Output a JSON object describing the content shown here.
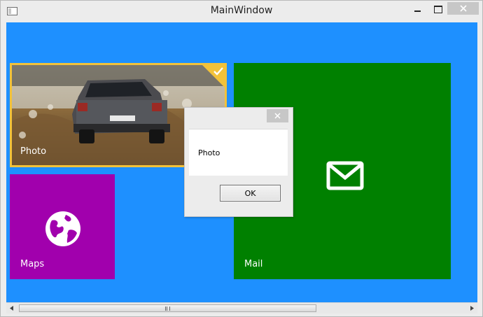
{
  "window": {
    "title": "MainWindow",
    "icons": {
      "app": "window-icon",
      "minimize": "minimize-icon",
      "maximize": "maximize-icon",
      "close": "close-icon"
    }
  },
  "tiles": [
    {
      "label": "Photo",
      "icon": "photo-car-image",
      "color": "#7a6a4e",
      "selected": true,
      "accent": "#f2c23a"
    },
    {
      "label": "Maps",
      "icon": "globe-icon",
      "color": "#a100ad"
    },
    {
      "label": "Mail",
      "icon": "envelope-icon",
      "color": "#008000"
    }
  ],
  "background_color": "#1e90ff",
  "dialog": {
    "message": "Photo",
    "ok_label": "OK",
    "close_icon": "close-icon"
  },
  "scrollbar": {
    "orientation": "horizontal",
    "position": 0
  }
}
